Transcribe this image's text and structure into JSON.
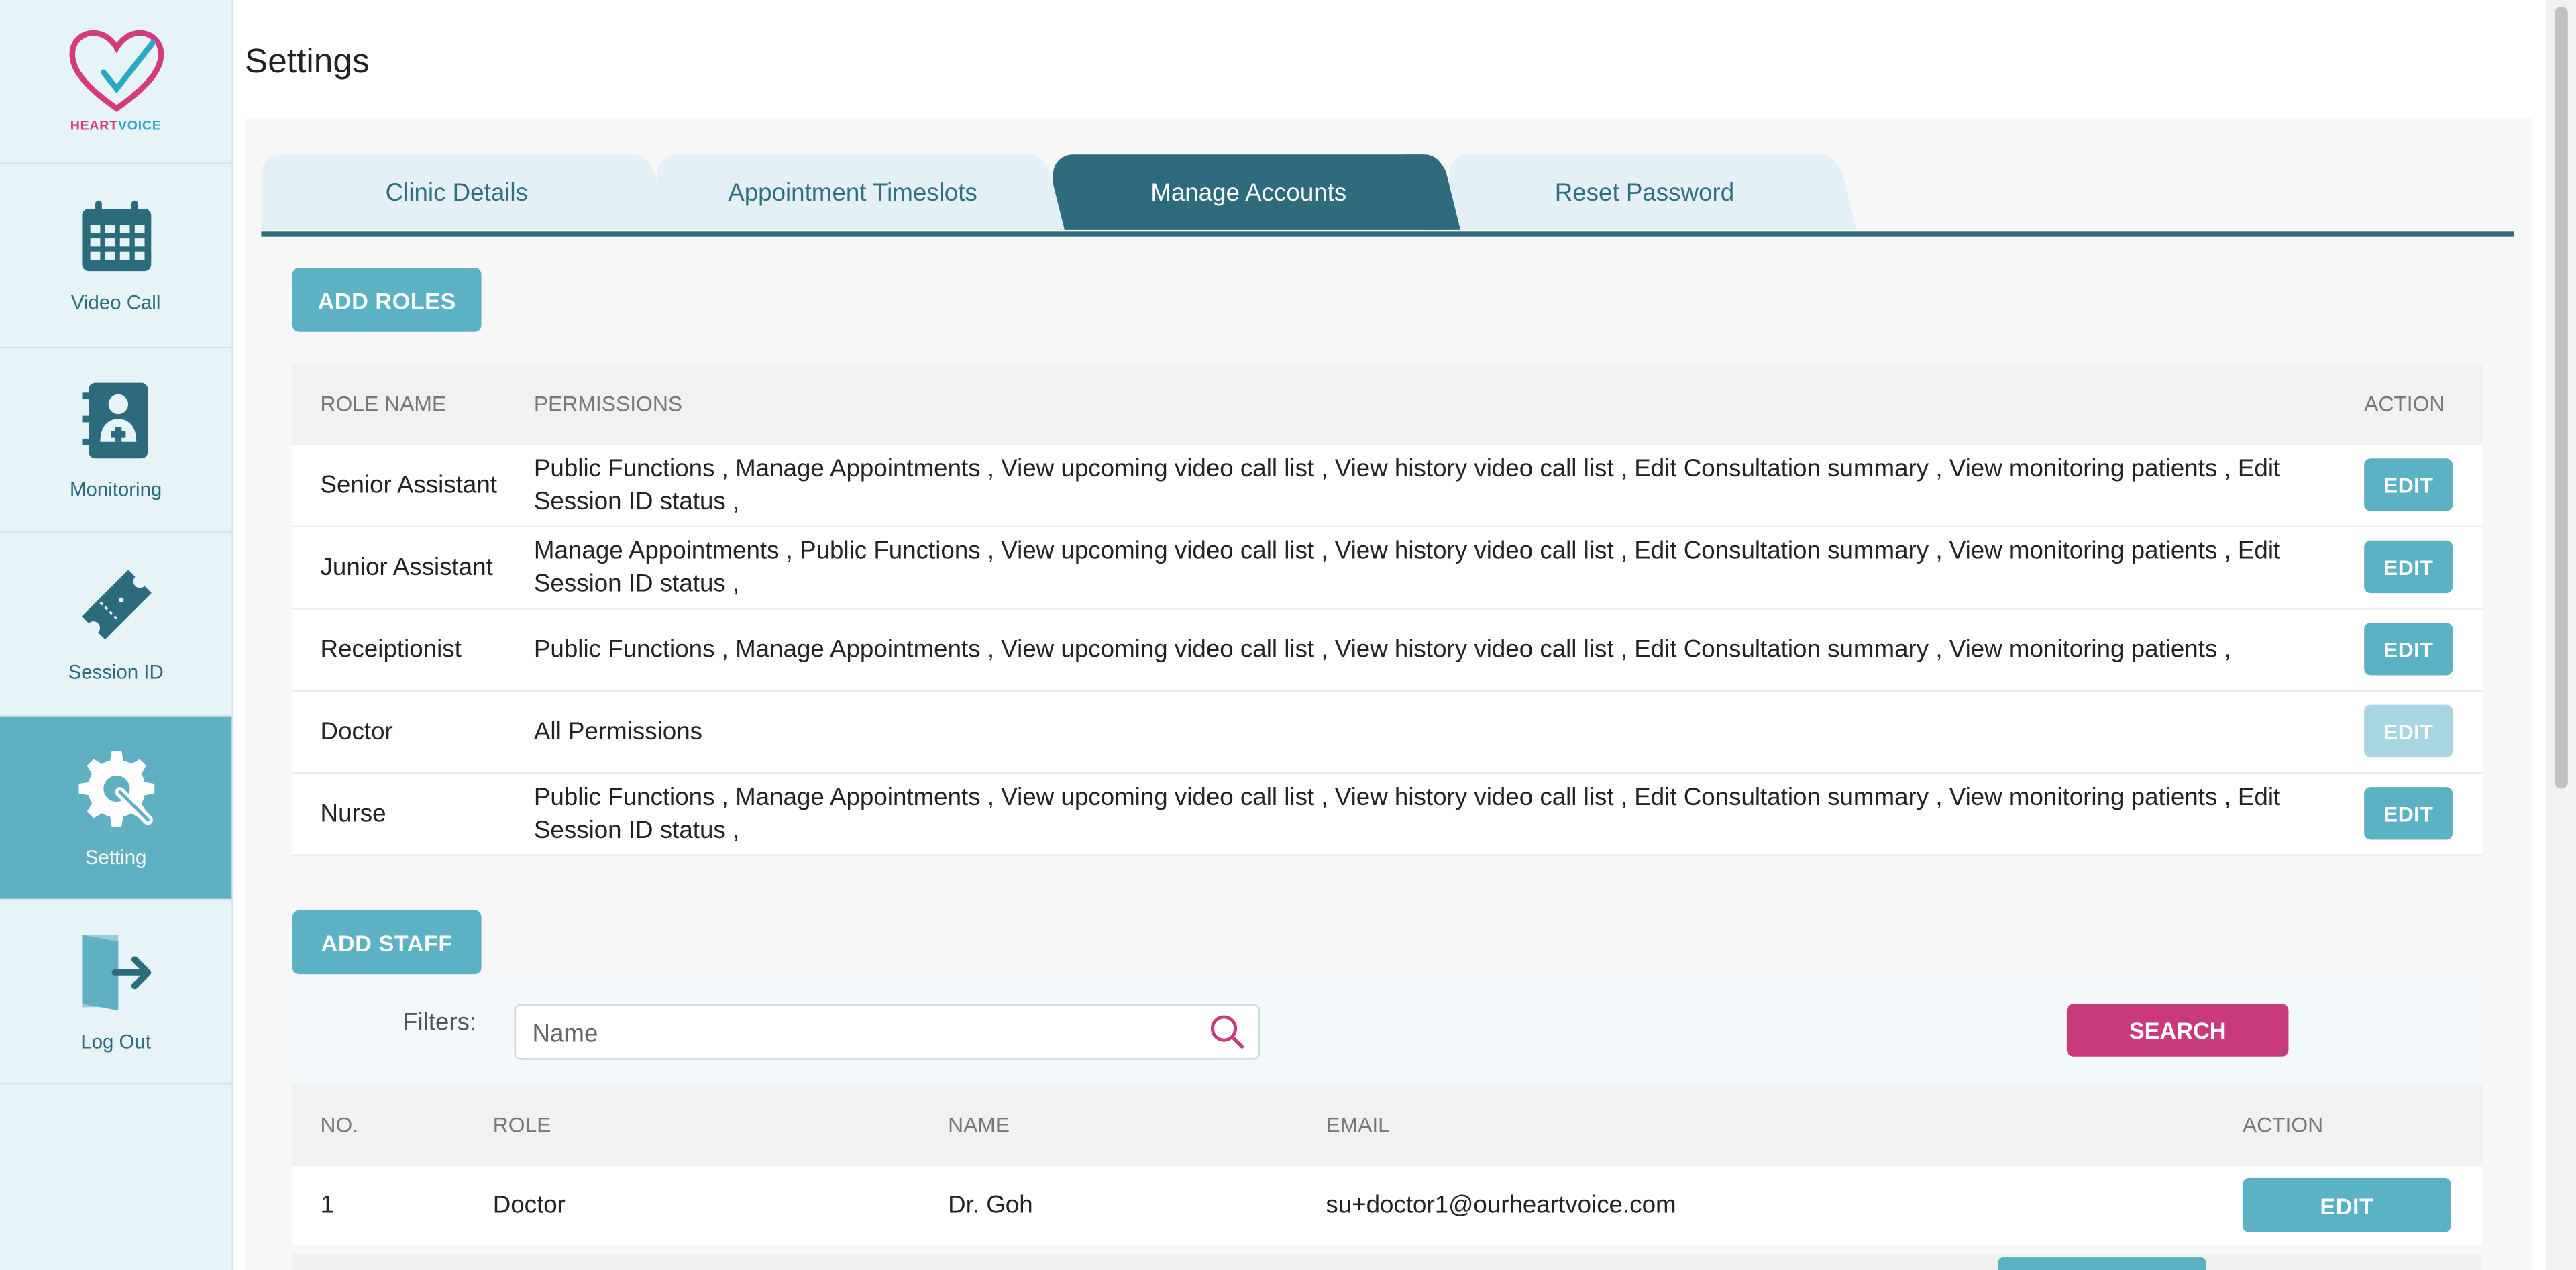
{
  "brand": {
    "logo_text_a": "HEART",
    "logo_text_b": "VOICE",
    "pink": "#d43a7c",
    "cyan": "#2aa8c8"
  },
  "sidebar": {
    "items": [
      {
        "label": "Video Call",
        "icon": "calendar-icon"
      },
      {
        "label": "Monitoring",
        "icon": "medical-book-icon"
      },
      {
        "label": "Session ID",
        "icon": "ticket-icon"
      },
      {
        "label": "Setting",
        "icon": "gear-wrench-icon",
        "active": true
      },
      {
        "label": "Log Out",
        "icon": "logout-icon"
      }
    ]
  },
  "page": {
    "title": "Settings"
  },
  "tabs": [
    {
      "label": "Clinic Details"
    },
    {
      "label": "Appointment Timeslots"
    },
    {
      "label": "Manage Accounts",
      "active": true
    },
    {
      "label": "Reset Password"
    }
  ],
  "roles": {
    "add_label": "ADD ROLES",
    "headers": {
      "name": "ROLE NAME",
      "permissions": "PERMISSIONS",
      "action": "ACTION"
    },
    "rows": [
      {
        "name": "Senior Assistant",
        "permissions": "Public Functions , Manage Appointments , View upcoming video call list , View history video call list , Edit Consultation summary , View monitoring patients , Edit Session ID status ,",
        "edit": "EDIT"
      },
      {
        "name": "Junior Assistant",
        "permissions": "Manage Appointments , Public Functions , View upcoming video call list , View history video call list , Edit Consultation summary , View monitoring patients , Edit Session ID status ,",
        "edit": "EDIT"
      },
      {
        "name": "Receiptionist",
        "permissions": "Public Functions , Manage Appointments , View upcoming video call list , View history video call list , Edit Consultation summary , View monitoring patients ,",
        "edit": "EDIT"
      },
      {
        "name": "Doctor",
        "permissions": "All Permissions",
        "edit": "EDIT",
        "disabled": true
      },
      {
        "name": "Nurse",
        "permissions": "Public Functions , Manage Appointments , View upcoming video call list , View history video call list , Edit Consultation summary , View monitoring patients , Edit Session ID status ,",
        "edit": "EDIT"
      }
    ]
  },
  "staff": {
    "add_label": "ADD STAFF",
    "filters_label": "Filters:",
    "search_placeholder": "Name",
    "search_label": "SEARCH",
    "headers": {
      "no": "NO.",
      "role": "ROLE",
      "name": "NAME",
      "email": "EMAIL",
      "action": "ACTION"
    },
    "rows": [
      {
        "no": "1",
        "role": "Doctor",
        "name": "Dr. Goh",
        "email": "su+doctor1@ourheartvoice.com",
        "edit": "EDIT"
      }
    ]
  },
  "colors": {
    "teal": "#5cb2c5",
    "dark_teal": "#2d6b7d",
    "magenta": "#c93a7a"
  }
}
